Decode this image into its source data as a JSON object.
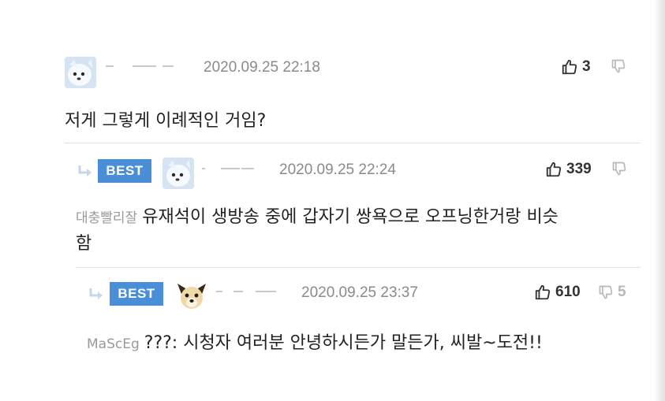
{
  "comments": [
    {
      "nickname": "",
      "date": "2020.09.25 22:18",
      "likes": "3",
      "dislikes": "",
      "text": "저게 그렇게 이례적인 거임?",
      "best": false
    },
    {
      "badge": "BEST",
      "nickname": "",
      "date": "2020.09.25 22:24",
      "likes": "339",
      "dislikes": "",
      "reply_to": "대충빨리잘",
      "text_line1": "유재석이 생방송 중에 갑자기 쌍욕으로 오프닝한거랑 비슷",
      "text_line2": "함",
      "best": true
    },
    {
      "badge": "BEST",
      "nickname": "",
      "date": "2020.09.25 23:37",
      "likes": "610",
      "dislikes": "5",
      "reply_to": "MaScEg",
      "text": "???: 시청자 여러분 안녕하시든가 말든가, 씨발~도전!!",
      "best": true
    }
  ],
  "icons": {
    "avatar_dog_white": "white-dog-avatar",
    "avatar_dog_tan": "tan-dog-avatar",
    "like": "thumbs-up-icon",
    "dislike": "thumbs-down-icon",
    "reply": "reply-arrow-icon"
  },
  "colors": {
    "best_badge": "#4a8ed8",
    "date": "#8a8a8a",
    "reply_prefix": "#999999",
    "separator": "#e1e1e1"
  }
}
